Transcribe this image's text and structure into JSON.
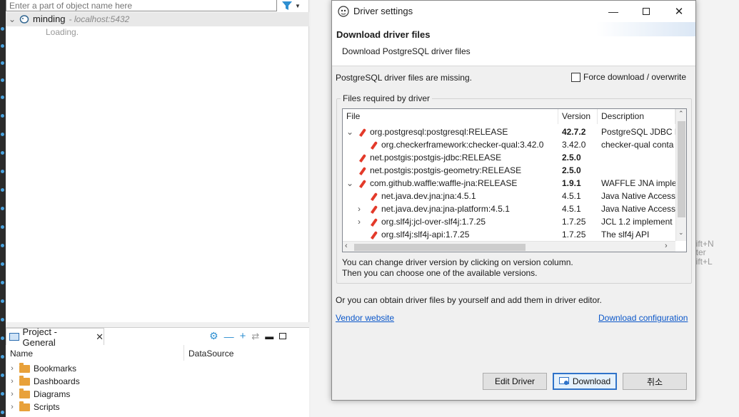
{
  "navigator": {
    "filter_placeholder": "Enter a part of object name here",
    "connection": {
      "name": "minding",
      "host": "- localhost:5432"
    },
    "loading": "Loading."
  },
  "shortcuts": [
    "nift+N",
    "nter",
    "nift+L"
  ],
  "project": {
    "tab_label": "Project - General",
    "columns": [
      "Name",
      "DataSource"
    ],
    "items": [
      "Bookmarks",
      "Dashboards",
      "Diagrams",
      "Scripts"
    ]
  },
  "dialog": {
    "title": "Driver settings",
    "header_title": "Download driver files",
    "header_subtitle": "Download PostgreSQL driver files",
    "missing_msg": "PostgreSQL driver files are missing.",
    "force_label": "Force download / overwrite",
    "group_label": "Files required by driver",
    "columns": [
      "File",
      "Version",
      "Description"
    ],
    "rows": [
      {
        "file": "org.postgresql:postgresql:RELEASE",
        "version": "42.7.2",
        "bold": true,
        "desc": "PostgreSQL JDBC D",
        "indent": 0,
        "toggle": "v"
      },
      {
        "file": "org.checkerframework:checker-qual:3.42.0",
        "version": "3.42.0",
        "bold": false,
        "desc": "checker-qual conta",
        "indent": 1,
        "toggle": ""
      },
      {
        "file": "net.postgis:postgis-jdbc:RELEASE",
        "version": "2.5.0",
        "bold": true,
        "desc": "",
        "indent": 0,
        "toggle": ""
      },
      {
        "file": "net.postgis:postgis-geometry:RELEASE",
        "version": "2.5.0",
        "bold": true,
        "desc": "",
        "indent": 0,
        "toggle": ""
      },
      {
        "file": "com.github.waffle:waffle-jna:RELEASE",
        "version": "1.9.1",
        "bold": true,
        "desc": "WAFFLE JNA imple",
        "indent": 0,
        "toggle": "v"
      },
      {
        "file": "net.java.dev.jna:jna:4.5.1",
        "version": "4.5.1",
        "bold": false,
        "desc": "Java Native Access",
        "indent": 1,
        "toggle": ""
      },
      {
        "file": "net.java.dev.jna:jna-platform:4.5.1",
        "version": "4.5.1",
        "bold": false,
        "desc": "Java Native Access",
        "indent": 1,
        "toggle": ">"
      },
      {
        "file": "org.slf4j:jcl-over-slf4j:1.7.25",
        "version": "1.7.25",
        "bold": false,
        "desc": "JCL 1.2 implement",
        "indent": 1,
        "toggle": ">"
      },
      {
        "file": "org.slf4j:slf4j-api:1.7.25",
        "version": "1.7.25",
        "bold": false,
        "desc": "The slf4j API",
        "indent": 1,
        "toggle": ""
      }
    ],
    "hint1": "You can change driver version by clicking on version column.",
    "hint2": "Then you can choose one of the available versions.",
    "obtain_msg": "Or you can obtain driver files by yourself and add them in driver editor.",
    "vendor_link": "Vendor website",
    "config_link": "Download configuration",
    "buttons": {
      "edit": "Edit Driver",
      "download": "Download",
      "cancel": "취소"
    }
  }
}
